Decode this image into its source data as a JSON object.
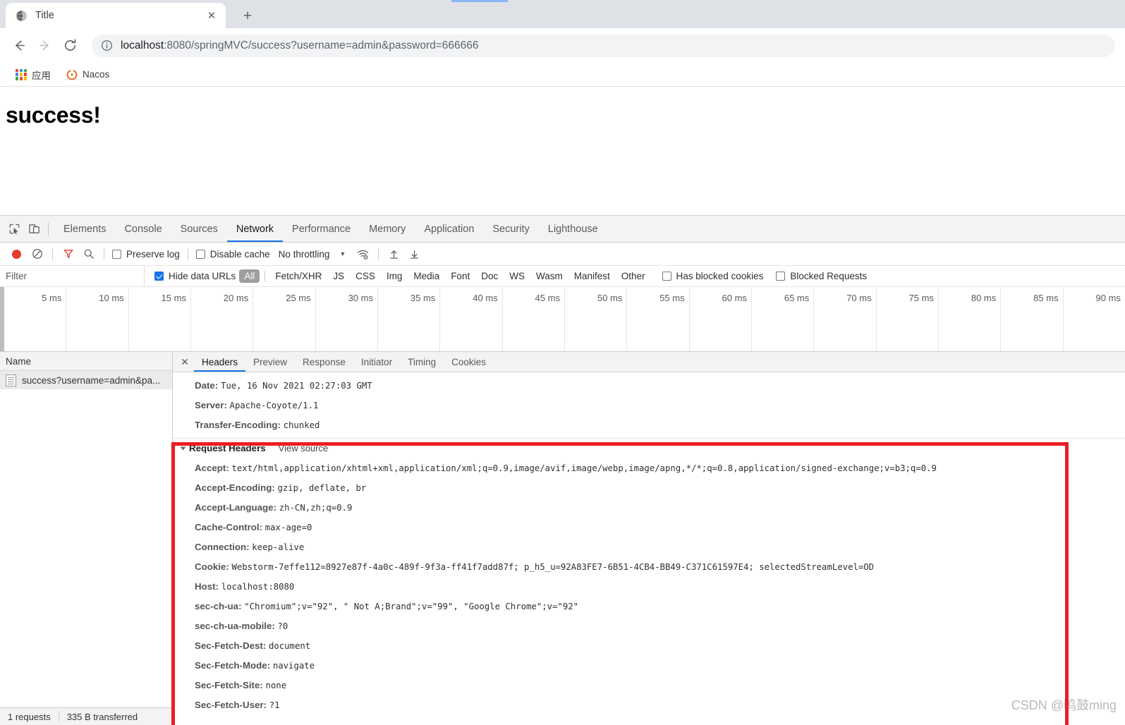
{
  "browser": {
    "tab": {
      "title": "Title",
      "favicon_icon": "globe-icon",
      "close_icon": "close-icon"
    },
    "newtab_icon": "plus-icon",
    "nav": {
      "back_icon": "arrow-left-icon",
      "forward_icon": "arrow-right-icon",
      "reload_icon": "reload-icon"
    },
    "omnibox": {
      "info_icon": "info-circle-icon",
      "url_host": "localhost",
      "url_rest": ":8080/springMVC/success?username=admin&password=666666",
      "full_url": "localhost:8080/springMVC/success?username=admin&password=666666"
    },
    "bookmarks": [
      {
        "label": "应用",
        "icon": "apps-grid-icon"
      },
      {
        "label": "Nacos",
        "icon": "nacos-icon"
      }
    ]
  },
  "page": {
    "heading": "success!"
  },
  "devtools": {
    "left_icons": [
      {
        "name": "inspect-element-icon"
      },
      {
        "name": "device-toolbar-icon"
      }
    ],
    "tabs": [
      {
        "label": "Elements",
        "active": false
      },
      {
        "label": "Console",
        "active": false
      },
      {
        "label": "Sources",
        "active": false
      },
      {
        "label": "Network",
        "active": true
      },
      {
        "label": "Performance",
        "active": false
      },
      {
        "label": "Memory",
        "active": false
      },
      {
        "label": "Application",
        "active": false
      },
      {
        "label": "Security",
        "active": false
      },
      {
        "label": "Lighthouse",
        "active": false
      }
    ],
    "toolbar": {
      "record_icon": "record-dot-icon",
      "clear_icon": "clear-no-entry-icon",
      "filter_icon": "funnel-filter-icon",
      "search_icon": "search-icon",
      "preserve_log_label": "Preserve log",
      "preserve_log_checked": false,
      "disable_cache_label": "Disable cache",
      "disable_cache_checked": false,
      "throttling_label": "No throttling",
      "throttle_caret_icon": "chevron-down-icon",
      "network_conditions_icon": "wifi-settings-icon",
      "import_har_icon": "upload-arrow-icon",
      "export_har_icon": "download-arrow-icon"
    },
    "filterbar": {
      "filter_placeholder": "Filter",
      "filter_value": "",
      "hide_data_urls_label": "Hide data URLs",
      "hide_data_urls_checked": true,
      "types": [
        "All",
        "Fetch/XHR",
        "JS",
        "CSS",
        "Img",
        "Media",
        "Font",
        "Doc",
        "WS",
        "Wasm",
        "Manifest",
        "Other"
      ],
      "selected_type": "All",
      "has_blocked_cookies_label": "Has blocked cookies",
      "has_blocked_cookies_checked": false,
      "blocked_requests_label": "Blocked Requests",
      "blocked_requests_checked": false
    },
    "overview": {
      "ticks": [
        "5 ms",
        "10 ms",
        "15 ms",
        "20 ms",
        "25 ms",
        "30 ms",
        "35 ms",
        "40 ms",
        "45 ms",
        "50 ms",
        "55 ms",
        "60 ms",
        "65 ms",
        "70 ms",
        "75 ms",
        "80 ms",
        "85 ms",
        "90 ms"
      ]
    },
    "request_list": {
      "column_header": "Name",
      "rows": [
        {
          "name": "success?username=admin&pa...",
          "icon": "document-icon",
          "selected": true
        }
      ]
    },
    "detail": {
      "close_icon": "close-icon",
      "tabs": [
        {
          "label": "Headers",
          "active": true
        },
        {
          "label": "Preview",
          "active": false
        },
        {
          "label": "Response",
          "active": false
        },
        {
          "label": "Initiator",
          "active": false
        },
        {
          "label": "Timing",
          "active": false
        },
        {
          "label": "Cookies",
          "active": false
        }
      ],
      "response_headers": [
        {
          "key": "Date:",
          "value": "Tue, 16 Nov 2021 02:27:03 GMT"
        },
        {
          "key": "Server:",
          "value": "Apache-Coyote/1.1"
        },
        {
          "key": "Transfer-Encoding:",
          "value": "chunked"
        }
      ],
      "request_headers_section": {
        "title": "Request Headers",
        "view_source_label": "View source",
        "expanded": true,
        "collapse_icon": "triangle-down-icon"
      },
      "request_headers": [
        {
          "key": "Accept:",
          "value": "text/html,application/xhtml+xml,application/xml;q=0.9,image/avif,image/webp,image/apng,*/*;q=0.8,application/signed-exchange;v=b3;q=0.9"
        },
        {
          "key": "Accept-Encoding:",
          "value": "gzip, deflate, br"
        },
        {
          "key": "Accept-Language:",
          "value": "zh-CN,zh;q=0.9"
        },
        {
          "key": "Cache-Control:",
          "value": "max-age=0"
        },
        {
          "key": "Connection:",
          "value": "keep-alive"
        },
        {
          "key": "Cookie:",
          "value": "Webstorm-7effe112=8927e87f-4a0c-489f-9f3a-ff41f7add87f; p_h5_u=92A83FE7-6B51-4CB4-BB49-C371C61597E4; selectedStreamLevel=OD"
        },
        {
          "key": "Host:",
          "value": "localhost:8080"
        },
        {
          "key": "sec-ch-ua:",
          "value": "\"Chromium\";v=\"92\", \" Not A;Brand\";v=\"99\", \"Google Chrome\";v=\"92\""
        },
        {
          "key": "sec-ch-ua-mobile:",
          "value": "?0"
        },
        {
          "key": "Sec-Fetch-Dest:",
          "value": "document"
        },
        {
          "key": "Sec-Fetch-Mode:",
          "value": "navigate"
        },
        {
          "key": "Sec-Fetch-Site:",
          "value": "none"
        },
        {
          "key": "Sec-Fetch-User:",
          "value": "?1"
        }
      ]
    },
    "statusbar": {
      "requests": "1 requests",
      "transferred": "335 B transferred"
    },
    "highlight_color": "#ed1c24"
  },
  "watermark": "CSDN @鸣鼓ming"
}
